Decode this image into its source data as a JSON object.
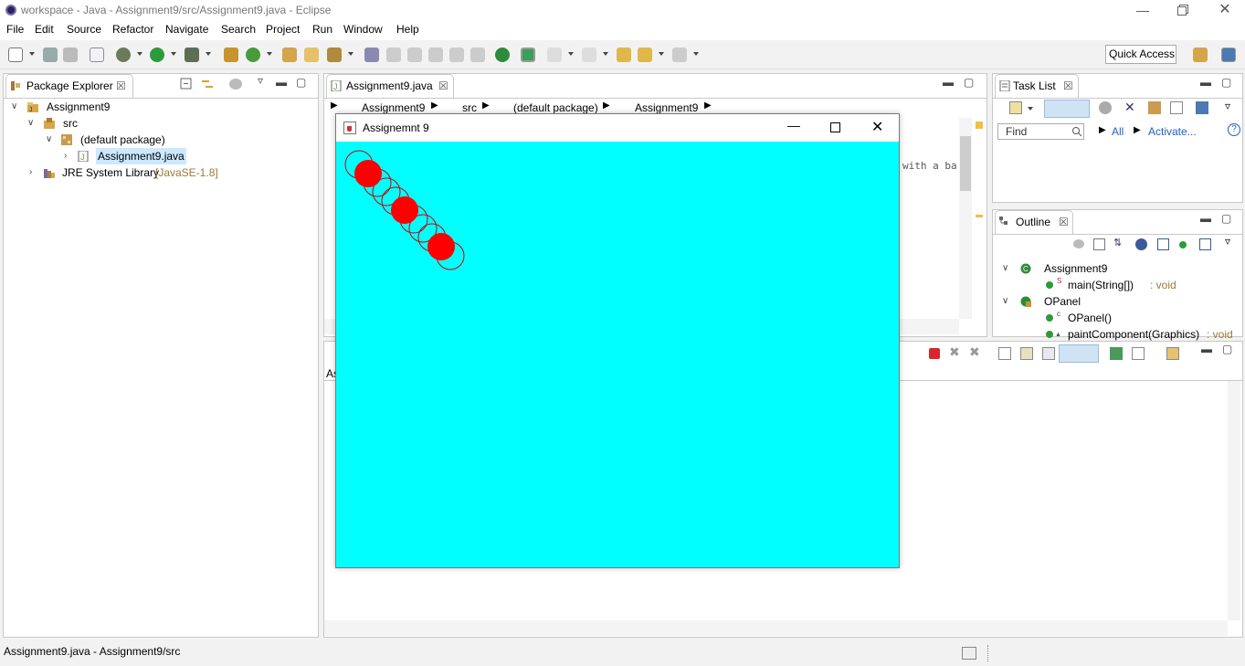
{
  "window": {
    "title": "workspace - Java - Assignment9/src/Assignment9.java - Eclipse"
  },
  "menubar": [
    "File",
    "Edit",
    "Source",
    "Refactor",
    "Navigate",
    "Search",
    "Project",
    "Run",
    "Window",
    "Help"
  ],
  "toolbar": {
    "quick_access": "Quick Access"
  },
  "package_explorer": {
    "tab_label": "Package Explorer",
    "tree": {
      "project": "Assignment9",
      "src": "src",
      "package": "(default package)",
      "file": "Assignment9.java",
      "jre": "JRE System Library",
      "jre_version": "[JavaSE-1.8]"
    }
  },
  "editor": {
    "tab_label": "Assignment9.java",
    "breadcrumb": [
      "Assignment9",
      "src",
      "(default package)",
      "Assignment9"
    ],
    "code_fragment": "with a ba"
  },
  "console": {
    "partial_label": "As"
  },
  "task_list": {
    "tab_label": "Task List",
    "find_placeholder": "Find",
    "all_label": "All",
    "activate_label": "Activate..."
  },
  "outline": {
    "tab_label": "Outline",
    "items": [
      {
        "label": "Assignment9",
        "kind": "class"
      },
      {
        "label": "main(String[])",
        "suffix": " : void",
        "modifier": "S"
      },
      {
        "label": "OPanel",
        "kind": "class"
      },
      {
        "label": "OPanel()",
        "modifier": "c"
      },
      {
        "label": "paintComponent(Graphics)",
        "suffix": " : void"
      }
    ]
  },
  "swing_window": {
    "title": "Assignemnt 9",
    "background_color": "#00ffff",
    "filled_circle_color": "#ff0000",
    "outline_circle_color": "#cc0000"
  },
  "status": {
    "text": "Assignment9.java - Assignment9/src"
  }
}
